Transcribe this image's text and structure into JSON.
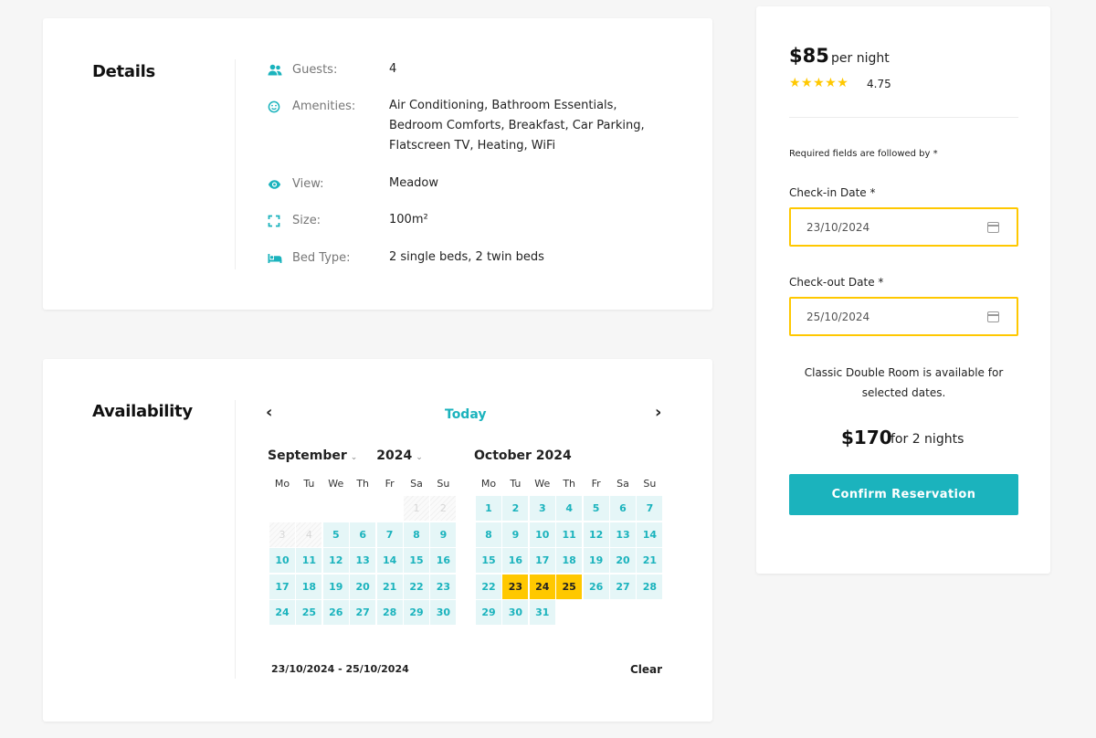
{
  "details": {
    "title": "Details",
    "rows": [
      {
        "icon": "guests-icon",
        "label": "Guests:",
        "value": "4"
      },
      {
        "icon": "smiley-icon",
        "label": "Amenities:",
        "value": "Air Conditioning, Bathroom Essentials, Bedroom Comforts, Breakfast, Car Parking, Flatscreen TV, Heating, WiFi"
      },
      {
        "icon": "eye-icon",
        "label": "View:",
        "value": "Meadow"
      },
      {
        "icon": "expand-icon",
        "label": "Size:",
        "value": "100m²"
      },
      {
        "icon": "bed-icon",
        "label": "Bed Type:",
        "value": "2 single beds, 2 twin beds"
      }
    ]
  },
  "availability": {
    "title": "Availability",
    "prev_icon": "‹",
    "next_icon": "›",
    "today_label": "Today",
    "weekdays": [
      "Mo",
      "Tu",
      "We",
      "Th",
      "Fr",
      "Sa",
      "Su"
    ],
    "months": [
      {
        "name": "September",
        "year": "2024",
        "header": "October 2024",
        "days_count": 30,
        "first_weekday": 6,
        "past_until": 4,
        "selected": []
      },
      {
        "name": "October",
        "year": "2024",
        "header": "October 2024",
        "days_count": 31,
        "first_weekday": 1,
        "past_until": 0,
        "selected": [
          23,
          24,
          25
        ]
      }
    ],
    "range_text": "23/10/2024 - 25/10/2024",
    "clear_label": "Clear"
  },
  "booking": {
    "price": "$85",
    "price_unit": "per night",
    "stars": "★★★★★",
    "rating": "4.75",
    "required_note": "Required fields are followed by *",
    "checkin_label": "Check-in Date *",
    "checkin_value": "23/10/2024",
    "checkout_label": "Check-out Date *",
    "checkout_value": "25/10/2024",
    "availability_note": "Classic Double Room is available for selected dates.",
    "total_price": "$170",
    "total_unit": "for 2 nights",
    "confirm_label": "Confirm Reservation"
  },
  "colors": {
    "accent": "#1bb3bd",
    "selected": "#ffc800",
    "day_bg": "#e5f6f7"
  }
}
